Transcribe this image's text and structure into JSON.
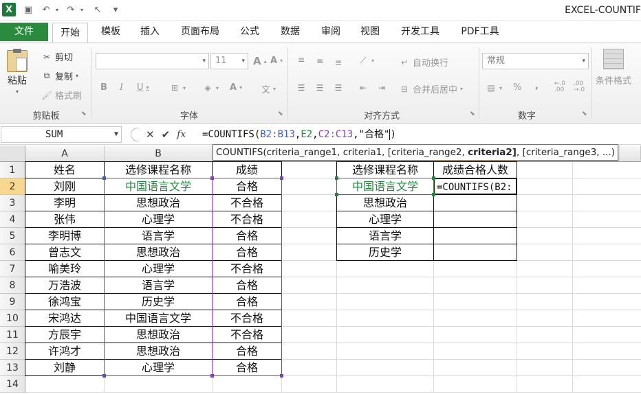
{
  "window": {
    "title": "EXCEL-COUNTIF"
  },
  "quick_access": {
    "app_icon": "X",
    "save_icon": "💾",
    "undo_icon": "↶",
    "redo_icon": "↷",
    "pointer_icon": "↖",
    "customize_icon": "▾"
  },
  "tabs": [
    {
      "label": "文件"
    },
    {
      "label": "开始"
    },
    {
      "label": "模板"
    },
    {
      "label": "插入"
    },
    {
      "label": "页面布局"
    },
    {
      "label": "公式"
    },
    {
      "label": "数据"
    },
    {
      "label": "审阅"
    },
    {
      "label": "视图"
    },
    {
      "label": "开发工具"
    },
    {
      "label": "PDF工具"
    }
  ],
  "ribbon": {
    "clipboard": {
      "paste": "粘贴",
      "cut": "剪切",
      "copy": "复制",
      "format_painter": "格式刷",
      "group": "剪贴板"
    },
    "font": {
      "size": "11",
      "group": "字体",
      "bold": "B",
      "italic": "I",
      "underline": "U",
      "grow": "A",
      "shrink": "A",
      "font_color": "A",
      "phonetic": "文"
    },
    "alignment": {
      "wrap": "自动换行",
      "merge": "合并后居中",
      "group": "对齐方式"
    },
    "number": {
      "format": "常规",
      "percent": "%",
      "comma": ",",
      "inc_decimal": "←.0\n.00",
      "dec_decimal": ".00\n→.0",
      "group": "数字"
    },
    "styles": {
      "conditional": "条件格式"
    }
  },
  "formula_bar": {
    "name_box": "SUM",
    "cancel_icon": "✕",
    "enter_icon": "✔",
    "fx_icon": "fx",
    "formula": {
      "prefix": "=COUNTIFS(",
      "range1": "B2:B13",
      "sep1": ",",
      "crit1": "E2",
      "sep2": ",",
      "range2": "C2:C13",
      "sep3": ",",
      "crit2": "\"合格\"",
      "suffix": ")"
    }
  },
  "tooltip": {
    "before": "COUNTIFS(criteria_range1, criteria1, [criteria_range2, ",
    "bold": "criteria2]",
    "after": ", [criteria_range3, ...)"
  },
  "columns": [
    "A",
    "B",
    "C",
    "D",
    "E",
    "F",
    "G",
    "H",
    "I"
  ],
  "rows": [
    "1",
    "2",
    "3",
    "4",
    "5",
    "6",
    "7",
    "8",
    "9",
    "10",
    "11",
    "12",
    "13",
    "14"
  ],
  "table_left": {
    "headers": [
      "姓名",
      "选修课程名称",
      "成绩"
    ],
    "rows": [
      [
        "刘刚",
        "中国语言文学",
        "合格"
      ],
      [
        "李明",
        "思想政治",
        "不合格"
      ],
      [
        "张伟",
        "心理学",
        "不合格"
      ],
      [
        "李明博",
        "语言学",
        "合格"
      ],
      [
        "曾志文",
        "思想政治",
        "合格"
      ],
      [
        "喻美玲",
        "心理学",
        "不合格"
      ],
      [
        "万浩波",
        "语言学",
        "合格"
      ],
      [
        "徐鸿宝",
        "历史学",
        "合格"
      ],
      [
        "宋鸿达",
        "中国语言文学",
        "不合格"
      ],
      [
        "方辰宇",
        "思想政治",
        "不合格"
      ],
      [
        "许鸿才",
        "思想政治",
        "合格"
      ],
      [
        "刘静",
        "心理学",
        "合格"
      ]
    ]
  },
  "table_right": {
    "headers": [
      "选修课程名称",
      "成绩合格人数"
    ],
    "courses": [
      "中国语言文学",
      "思想政治",
      "心理学",
      "语言学",
      "历史学"
    ],
    "editing_cell": "=COUNTIFS(B2:"
  },
  "colors": {
    "file_tab": "#2a8a3e",
    "ref_blue": "#3b5cc8",
    "ref_green": "#1f8a3b",
    "ref_purple": "#8a3bbf",
    "selected_header": "#f6d88f"
  }
}
